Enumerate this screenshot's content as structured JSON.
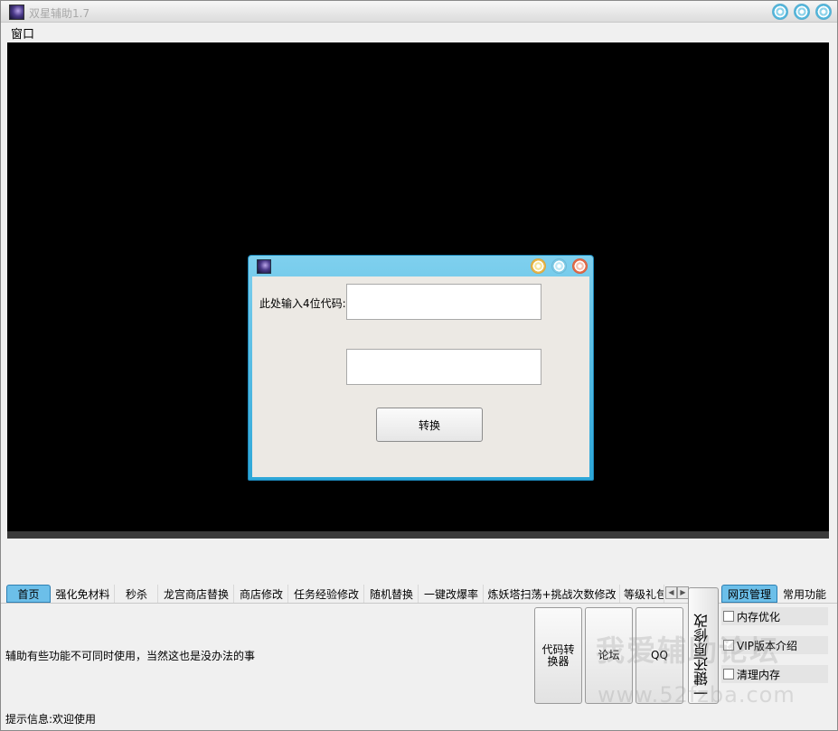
{
  "window": {
    "title": "双星辅助1.7"
  },
  "menu": {
    "items": [
      "窗口"
    ]
  },
  "dialog": {
    "label": "此处输入4位代码:",
    "input1_value": "",
    "input2_value": "",
    "button": "转换"
  },
  "tabs": {
    "left": [
      "首页",
      "强化免材料",
      "秒杀",
      "龙宫商店替换",
      "商店修改",
      "任务经验修改",
      "随机替换",
      "一键改爆率",
      "炼妖塔扫荡+挑战次数修改",
      "等级礼包"
    ],
    "right": [
      "网页管理",
      "常用功能"
    ]
  },
  "panel": {
    "notice": "辅助有些功能不可同时使用，当然这也是没办法的事",
    "status": "提示信息:欢迎使用",
    "buttons": [
      "代码转换器",
      "论坛",
      "QQ"
    ],
    "vertical_button": "一键还原修改",
    "options": [
      "内存优化",
      "VIP版本介绍",
      "清理内存"
    ]
  },
  "watermark": {
    "line1": "我爱辅助论坛",
    "line2": "www.52fzba.com"
  }
}
